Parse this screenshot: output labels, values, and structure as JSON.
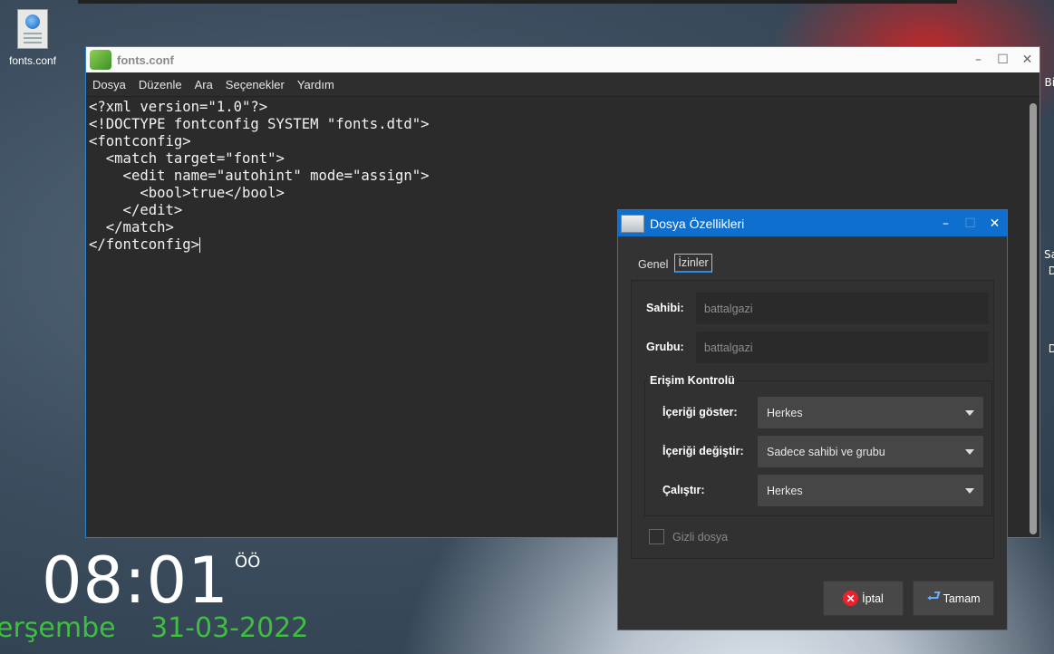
{
  "desktop": {
    "icon_label": "fonts.conf",
    "clock_time": "08:01",
    "clock_ampm": "ÖÖ",
    "day": "erşembe",
    "date": "31-03-2022",
    "edge_texts": [
      "Bir",
      "Sa",
      "D",
      "D"
    ]
  },
  "editor": {
    "title": "fonts.conf",
    "menu": [
      "Dosya",
      "Düzenle",
      "Ara",
      "Seçenekler",
      "Yardım"
    ],
    "lines": [
      "<?xml version=\"1.0\"?>",
      "<!DOCTYPE fontconfig SYSTEM \"fonts.dtd\">",
      "<fontconfig>",
      "  <match target=\"font\">",
      "    <edit name=\"autohint\" mode=\"assign\">",
      "      <bool>true</bool>",
      "    </edit>",
      "  </match>",
      "</fontconfig>"
    ],
    "controls": {
      "minimize": "–",
      "maximize": "☐",
      "close": "✕"
    }
  },
  "dialog": {
    "title": "Dosya Özellikleri",
    "tabs": [
      "Genel",
      "İzinler"
    ],
    "owner_label": "Sahibi:",
    "owner_value": "battalgazi",
    "group_label": "Grubu:",
    "group_value": "battalgazi",
    "access_title": "Erişim Kontrolü",
    "view_label": "İçeriği göster:",
    "view_value": "Herkes",
    "change_label": "İçeriği değiştir:",
    "change_value": "Sadece sahibi ve grubu",
    "exec_label": "Çalıştır:",
    "exec_value": "Herkes",
    "hidden_label": "Gizli dosya",
    "cancel_label": "İptal",
    "ok_label": "Tamam",
    "controls": {
      "minimize": "–",
      "maximize": "☐",
      "close": "✕"
    }
  }
}
